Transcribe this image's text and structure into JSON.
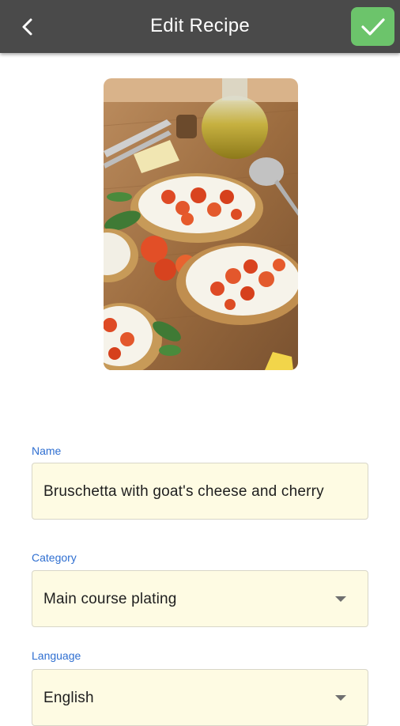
{
  "header": {
    "title": "Edit Recipe",
    "back_icon": "back-arrow-icon",
    "save_icon": "checkmark-icon",
    "bar_color": "#4a4a4a",
    "save_color": "#6cc46b"
  },
  "recipe_image": {
    "subject": "bruschetta with goat's cheese and cherry tomatoes on a wooden board"
  },
  "form": {
    "name": {
      "label": "Name",
      "value": "Bruschetta with goat's cheese and cherry"
    },
    "category": {
      "label": "Category",
      "value": "Main course plating"
    },
    "language": {
      "label": "Language",
      "value": "English"
    },
    "label_color": "#2f6fd1",
    "field_background": "#fefbe3"
  }
}
